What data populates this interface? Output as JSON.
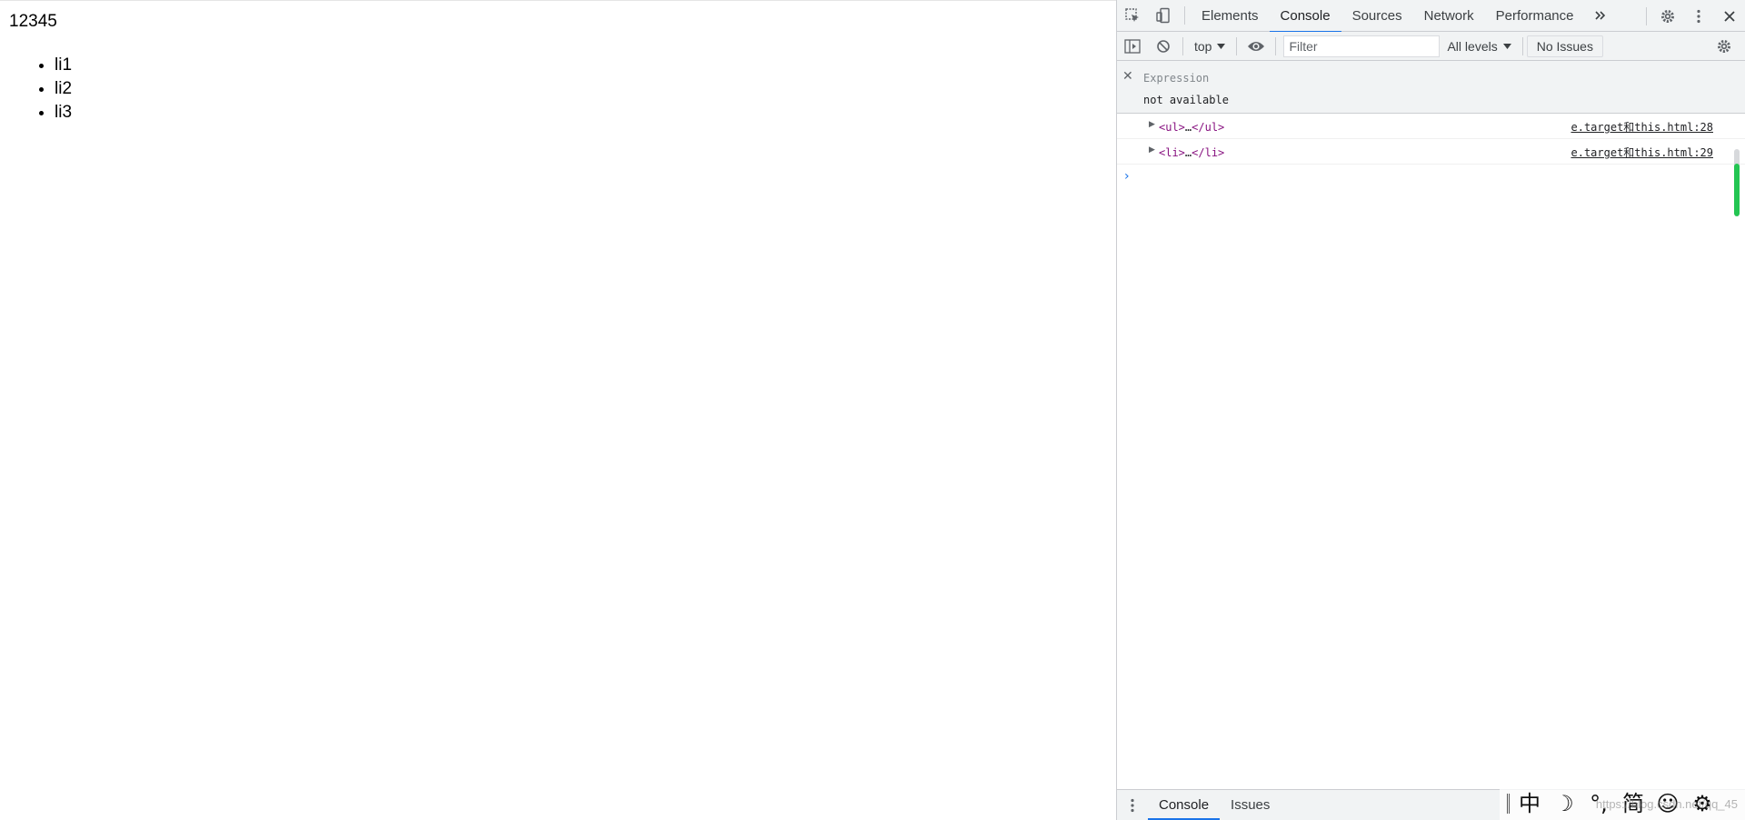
{
  "page": {
    "text": "12345",
    "list_items": [
      "li1",
      "li2",
      "li3"
    ]
  },
  "devtools": {
    "tabs": [
      "Elements",
      "Console",
      "Sources",
      "Network",
      "Performance"
    ],
    "active_tab": "Console",
    "more_tabs_icon": "chevron-double-right-icon",
    "toolbar": {
      "context": "top",
      "filter_placeholder": "Filter",
      "levels": "All levels",
      "issues": "No Issues"
    },
    "expression": {
      "label": "Expression",
      "value": "not available"
    },
    "logs": [
      {
        "open": "<ul>",
        "ellipsis": "…",
        "close": "</ul>",
        "source": "e.target和this.html:28"
      },
      {
        "open": "<li>",
        "ellipsis": "…",
        "close": "</li>",
        "source": "e.target和this.html:29"
      }
    ],
    "prompt": "›",
    "drawer": {
      "tabs": [
        "Console",
        "Issues"
      ],
      "active_tab": "Console"
    },
    "scrollbar": {
      "accent": "#23c552"
    }
  },
  "ime_toolbar": {
    "items": [
      "中",
      "☽",
      "°,",
      "简",
      "☺",
      "⚙"
    ],
    "watermark": "https://blog.csdn.net/qq_45"
  },
  "colors": {
    "accent": "#1a73e8",
    "toolbar_bg": "#f1f3f4",
    "tag": "#881280"
  }
}
